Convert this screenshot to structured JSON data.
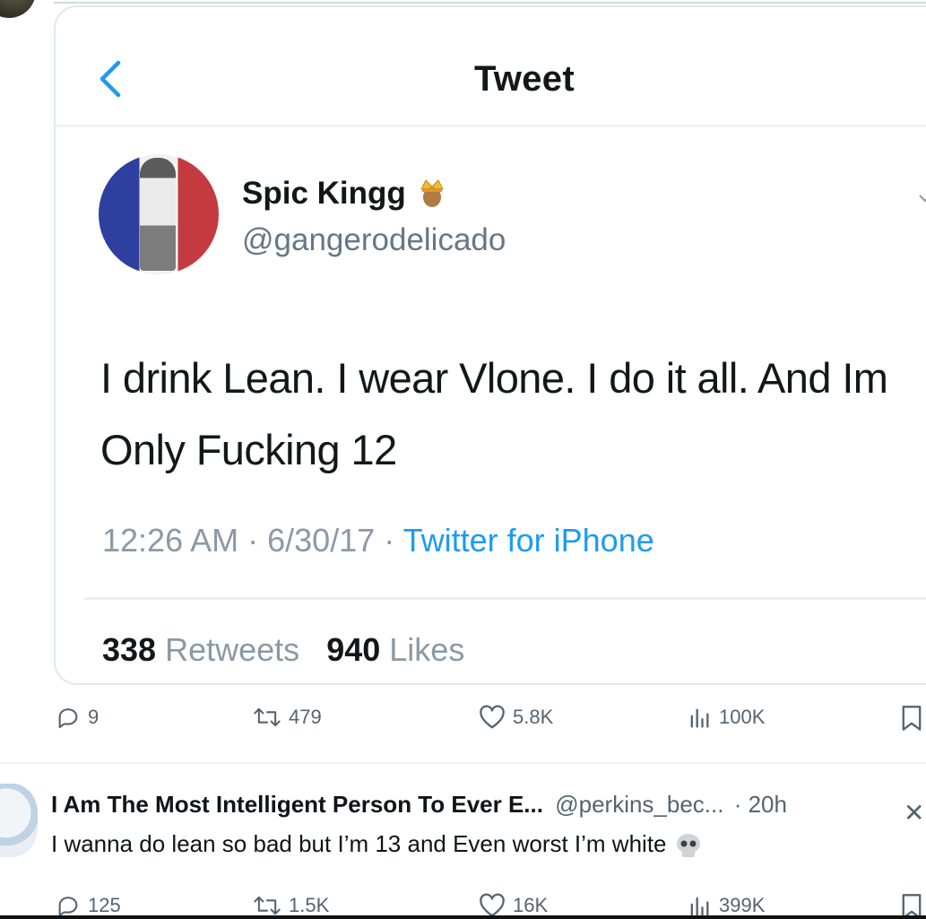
{
  "header": {
    "title": "Tweet"
  },
  "tweet": {
    "display_name": "Spic Kingg",
    "handle": "@gangerodelicado",
    "text": "I drink Lean. I wear Vlone. I do it all. And Im Only Fucking 12",
    "time": "12:26 AM",
    "date": "6/30/17",
    "source": "Twitter for iPhone",
    "retweets_count": "338",
    "retweets_label": "Retweets",
    "likes_count": "940",
    "likes_label": "Likes"
  },
  "post_actions": {
    "replies": "9",
    "reposts": "479",
    "likes": "5.8K",
    "views": "100K"
  },
  "reply": {
    "name": "I Am The Most Intelligent Person To Ever E...",
    "handle": "@perkins_bec...",
    "time": "· 20h",
    "text": "I wanna do lean so bad but I’m 13 and Even worst I’m white",
    "actions": {
      "replies": "125",
      "reposts": "1.5K",
      "likes": "16K",
      "views": "399K"
    }
  },
  "icons": {
    "back": "chevron-left-icon",
    "crown": "crown-emoji-icon",
    "reply": "reply-icon",
    "repost": "repost-icon",
    "like": "heart-icon",
    "views": "views-icon",
    "bookmark": "bookmark-icon",
    "skull": "skull-emoji-icon"
  },
  "colors": {
    "link": "#1d9bf0",
    "muted": "#536471",
    "text": "#0f1419"
  }
}
